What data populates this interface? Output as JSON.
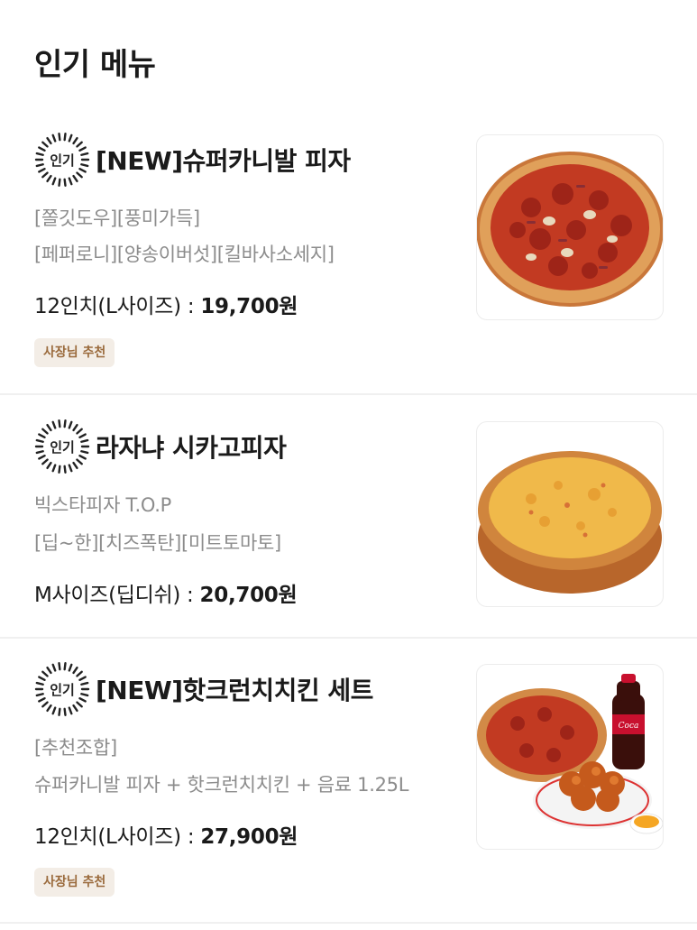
{
  "section": {
    "title": "인기 메뉴"
  },
  "popular_label": "인기",
  "items": [
    {
      "name": "[NEW]슈퍼카니발 피자",
      "desc": [
        "[쫄깃도우][풍미가득]",
        "[페퍼로니][양송이버섯][킬바사소세지]"
      ],
      "size_label": "12인치(L사이즈) : ",
      "price": "19,700원",
      "badge": "사장님 추천",
      "image_icon": "pizza-image"
    },
    {
      "name": "라자냐 시카고피자",
      "desc": [
        "빅스타피자 T.O.P",
        "[딥~한][치즈폭탄][미트토마토]"
      ],
      "size_label": "M사이즈(딥디쉬) : ",
      "price": "20,700원",
      "badge": "",
      "image_icon": "deep-dish-pizza-image"
    },
    {
      "name": "[NEW]핫크런치치킨 세트",
      "desc": [
        "[추천조합]",
        "슈퍼카니발 피자 + 핫크런치치킨 + 음료 1.25L"
      ],
      "size_label": "12인치(L사이즈) : ",
      "price": "27,900원",
      "badge": "사장님 추천",
      "image_icon": "pizza-chicken-cola-set-image"
    }
  ]
}
